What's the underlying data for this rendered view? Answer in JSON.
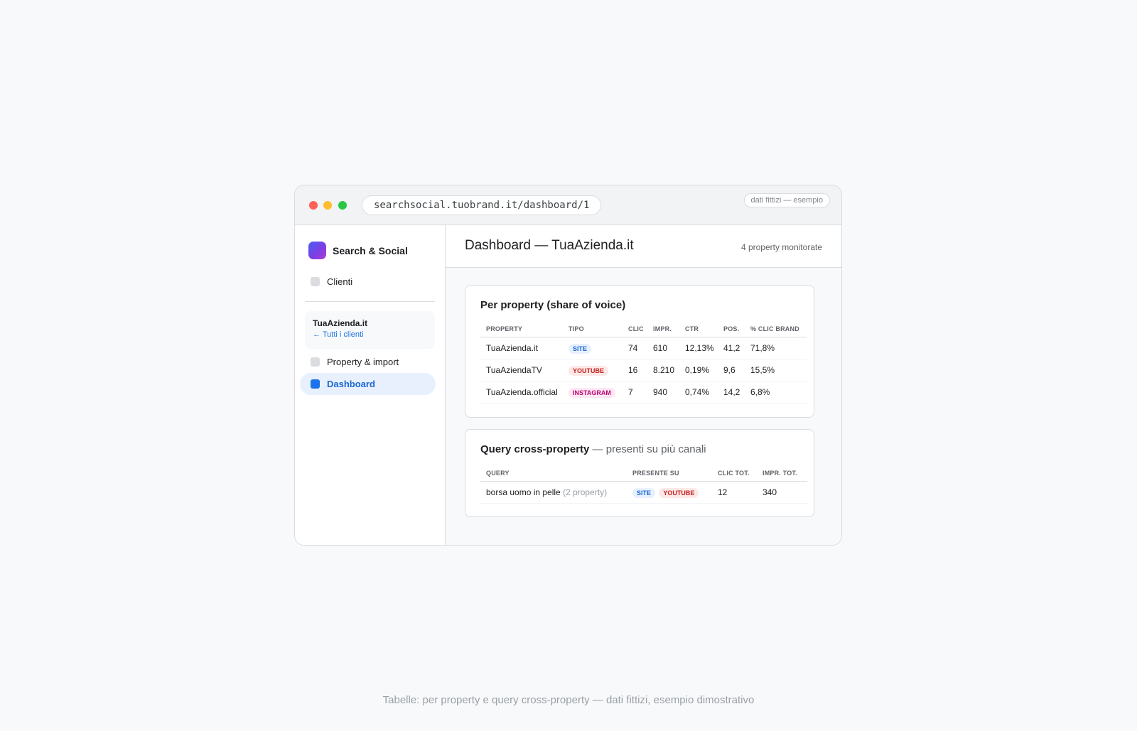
{
  "browser": {
    "url": "searchsocial.tuobrand.it/dashboard/1",
    "demo_badge": "dati fittizi — esempio"
  },
  "sidebar": {
    "brand": "Search & Social",
    "items": [
      {
        "label": "Clienti",
        "icon": "square-icon"
      },
      {
        "label": "Property & import",
        "icon": "square-icon"
      },
      {
        "label": "Dashboard",
        "icon": "square-icon",
        "active": true
      }
    ],
    "client": {
      "name": "TuaAzienda.it",
      "back_link": "← Tutti i clienti"
    }
  },
  "header": {
    "title": "Dashboard — TuaAzienda.it",
    "meta": "4 property monitorate"
  },
  "per_property": {
    "title": "Per property (share of voice)",
    "columns": [
      "Property",
      "Tipo",
      "Clic",
      "Impr.",
      "CTR",
      "Pos.",
      "% clic brand"
    ],
    "rows": [
      {
        "property": "TuaAzienda.it",
        "tipo": "site",
        "clic": "74",
        "impr": "610",
        "ctr": "12,13%",
        "pos": "41,2",
        "brand": "71,8%"
      },
      {
        "property": "TuaAziendaTV",
        "tipo": "youtube",
        "clic": "16",
        "impr": "8.210",
        "ctr": "0,19%",
        "pos": "9,6",
        "brand": "15,5%"
      },
      {
        "property": "TuaAzienda.official",
        "tipo": "instagram",
        "clic": "7",
        "impr": "940",
        "ctr": "0,74%",
        "pos": "14,2",
        "brand": "6,8%"
      }
    ]
  },
  "cross_property": {
    "title": "Query cross-property",
    "subtitle": " — presenti su più canali",
    "columns": [
      "Query",
      "Presente su",
      "Clic tot.",
      "Impr. tot."
    ],
    "rows": [
      {
        "query": "borsa uomo in pelle",
        "note": "(2 property)",
        "channels": [
          "site",
          "youtube"
        ],
        "clic": "12",
        "impr": "340"
      }
    ]
  },
  "caption": "Tabelle: per property e query cross-property — dati fittizi, esempio dimostrativo",
  "colors": {
    "accent": "#1a73e8",
    "site": "#1967d2",
    "youtube": "#c5221f",
    "instagram": "#b80672"
  }
}
